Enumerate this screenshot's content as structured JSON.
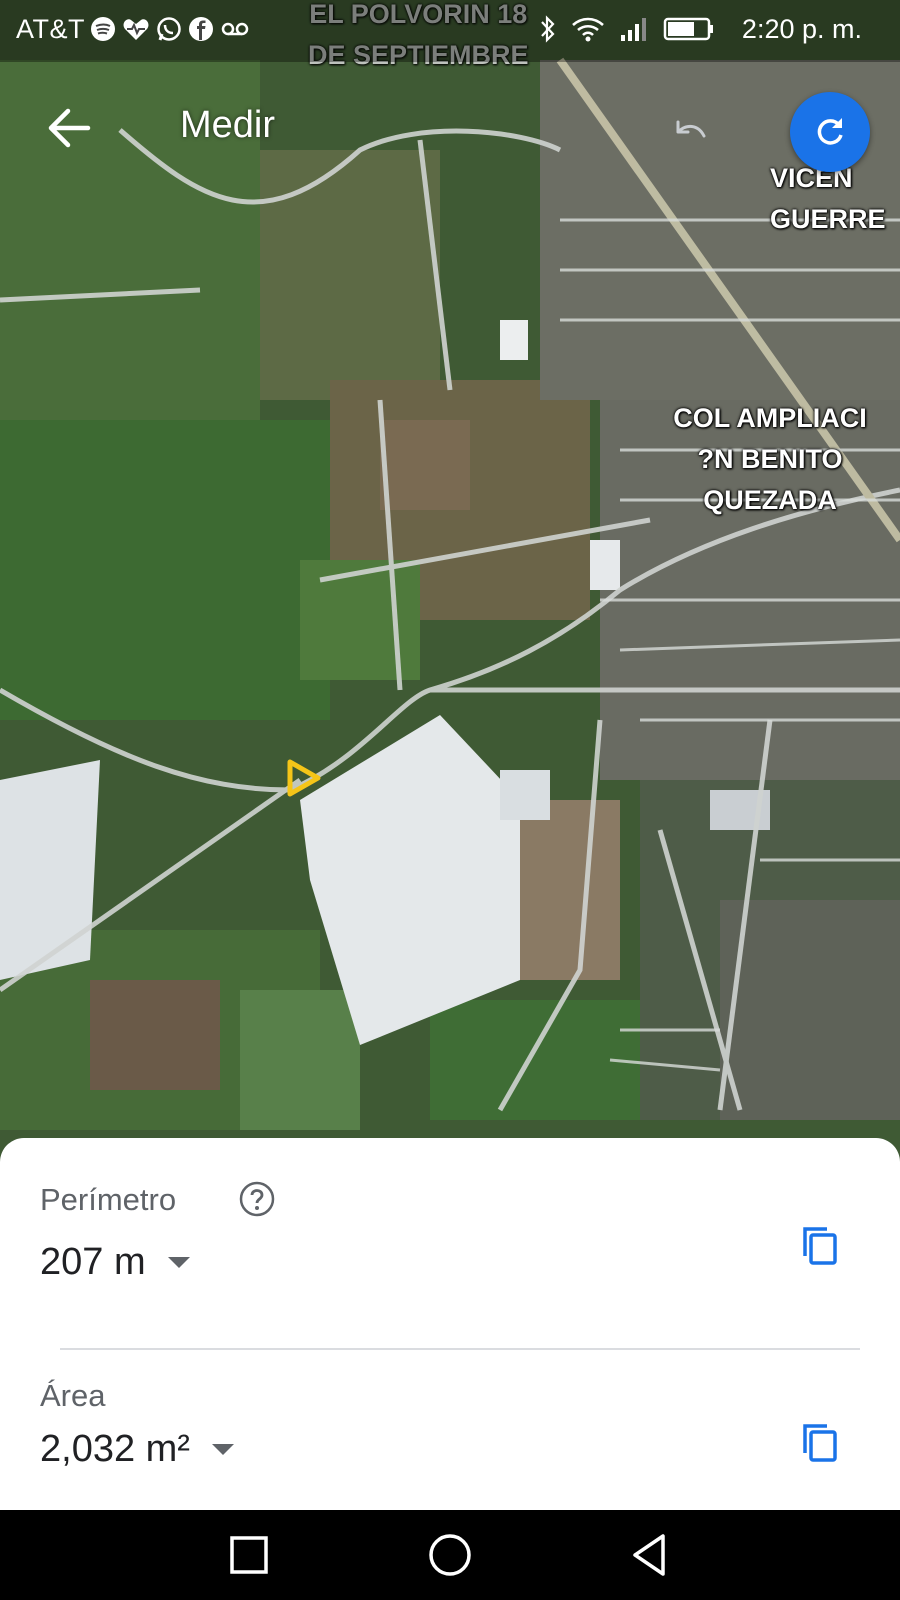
{
  "status_bar": {
    "carrier": "AT&T",
    "time": "2:20 p. m.",
    "notification_icons": [
      "spotify-icon",
      "health-icon",
      "whatsapp-icon",
      "facebook-icon",
      "voicemail-icon"
    ],
    "system_icons": [
      "bluetooth-icon",
      "wifi-icon",
      "signal-icon",
      "battery-icon"
    ]
  },
  "header": {
    "title": "Medir",
    "back_icon": "arrow-left-icon",
    "undo_icon": "undo-icon",
    "refresh_icon": "refresh-icon"
  },
  "map": {
    "type": "satellite",
    "labels": {
      "polvorin": "EL POLVORIN 18\nDE SEPTIEMBRE",
      "vicente": "VICEN\nGUERRE",
      "ampliacion": "COL AMPLIACI\n?N BENITO\nQUEZADA"
    }
  },
  "measurement": {
    "perimeter": {
      "label": "Perímetro",
      "value": "207 m"
    },
    "area": {
      "label": "Área",
      "value": "2,032 m²"
    }
  },
  "colors": {
    "accent": "#1a73e8",
    "label_gray": "#5f6368",
    "value_dark": "#202124",
    "marker": "#f5c518"
  },
  "nav_bar": {
    "buttons": [
      "recents-square-icon",
      "home-circle-icon",
      "back-triangle-icon"
    ]
  }
}
